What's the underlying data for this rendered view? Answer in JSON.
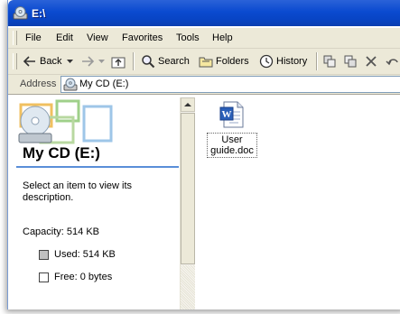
{
  "window": {
    "title": "E:\\"
  },
  "menu": [
    "File",
    "Edit",
    "View",
    "Favorites",
    "Tools",
    "Help"
  ],
  "toolbar": {
    "back": "Back",
    "search": "Search",
    "folders": "Folders",
    "history": "History"
  },
  "address": {
    "label": "Address",
    "value": "My CD (E:)"
  },
  "details": {
    "title": "My CD (E:)",
    "description": "Select an item to view its description.",
    "capacity": "Capacity: 514 KB",
    "used": "Used: 514 KB",
    "free": "Free: 0 bytes",
    "used_color": "#c0c0c0",
    "free_color": "#ffffff"
  },
  "files": [
    {
      "name": "User guide.doc",
      "icon": "word-document-icon"
    }
  ],
  "colors": {
    "titlebar": "#0a4ad0",
    "chrome": "#ece9d8",
    "accent_line": "#5a8ed8"
  }
}
